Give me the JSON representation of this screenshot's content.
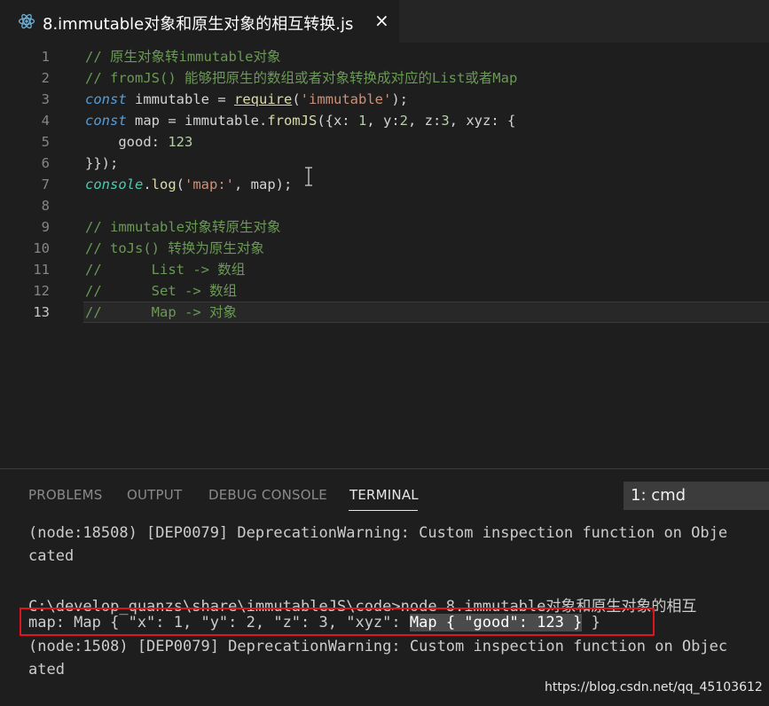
{
  "tab": {
    "icon": "react-atom-icon",
    "title": "8.immutable对象和原生对象的相互转换.js",
    "close": "×"
  },
  "editor": {
    "active_line": 13,
    "lines": [
      {
        "n": "1",
        "tokens": [
          {
            "c": "cm",
            "t": "// 原生对象转immutable对象"
          }
        ]
      },
      {
        "n": "2",
        "tokens": [
          {
            "c": "cm",
            "t": "// fromJS() 能够把原生的数组或者对象转换成对应的List或者Map"
          }
        ]
      },
      {
        "n": "3",
        "tokens": [
          {
            "c": "kw",
            "t": "const"
          },
          {
            "c": "id",
            "t": " immutable = "
          },
          {
            "c": "req",
            "t": "require"
          },
          {
            "c": "id",
            "t": "("
          },
          {
            "c": "str",
            "t": "'immutable'"
          },
          {
            "c": "id",
            "t": ");"
          }
        ]
      },
      {
        "n": "4",
        "tokens": [
          {
            "c": "kw",
            "t": "const"
          },
          {
            "c": "id",
            "t": " map = immutable."
          },
          {
            "c": "fn",
            "t": "fromJS"
          },
          {
            "c": "id",
            "t": "({x: "
          },
          {
            "c": "num",
            "t": "1"
          },
          {
            "c": "id",
            "t": ", y:"
          },
          {
            "c": "num",
            "t": "2"
          },
          {
            "c": "id",
            "t": ", z:"
          },
          {
            "c": "num",
            "t": "3"
          },
          {
            "c": "id",
            "t": ", xyz: {"
          }
        ]
      },
      {
        "n": "5",
        "tokens": [
          {
            "c": "id",
            "t": "    good: "
          },
          {
            "c": "num",
            "t": "123"
          }
        ]
      },
      {
        "n": "6",
        "tokens": [
          {
            "c": "id",
            "t": "}});"
          }
        ]
      },
      {
        "n": "7",
        "tokens": [
          {
            "c": "obj",
            "t": "console"
          },
          {
            "c": "id",
            "t": "."
          },
          {
            "c": "fn",
            "t": "log"
          },
          {
            "c": "id",
            "t": "("
          },
          {
            "c": "str",
            "t": "'map:'"
          },
          {
            "c": "id",
            "t": ", map);"
          }
        ]
      },
      {
        "n": "8",
        "tokens": []
      },
      {
        "n": "9",
        "tokens": [
          {
            "c": "cm",
            "t": "// immutable对象转原生对象"
          }
        ]
      },
      {
        "n": "10",
        "tokens": [
          {
            "c": "cm",
            "t": "// toJs() 转换为原生对象"
          }
        ]
      },
      {
        "n": "11",
        "tokens": [
          {
            "c": "cm",
            "t": "//      List -> 数组"
          }
        ]
      },
      {
        "n": "12",
        "tokens": [
          {
            "c": "cm",
            "t": "//      Set -> 数组"
          }
        ]
      },
      {
        "n": "13",
        "tokens": [
          {
            "c": "cm",
            "t": "//      Map -> 对象"
          }
        ]
      }
    ]
  },
  "panel": {
    "tabs": [
      "PROBLEMS",
      "OUTPUT",
      "DEBUG CONSOLE",
      "TERMINAL"
    ],
    "active_tab": "TERMINAL",
    "terminal_select": "1: cmd",
    "terminal_lines": [
      "(node:18508) [DEP0079] DeprecationWarning: Custom inspection function on Obje",
      "cated",
      "",
      "C:\\develop_quanzs\\share\\immutableJS\\code>node 8.immutable对象和原生对象的相互"
    ],
    "output_prefix": "map: Map { \"x\": 1, \"y\": 2, \"z\": 3, \"xyz\": ",
    "output_highlight": "Map { \"good\": 123 }",
    "output_suffix": " }",
    "terminal_lines_after": [
      "(node:1508) [DEP0079] DeprecationWarning: Custom inspection function on Objec",
      "ated"
    ]
  },
  "watermark": "https://blog.csdn.net/qq_45103612"
}
